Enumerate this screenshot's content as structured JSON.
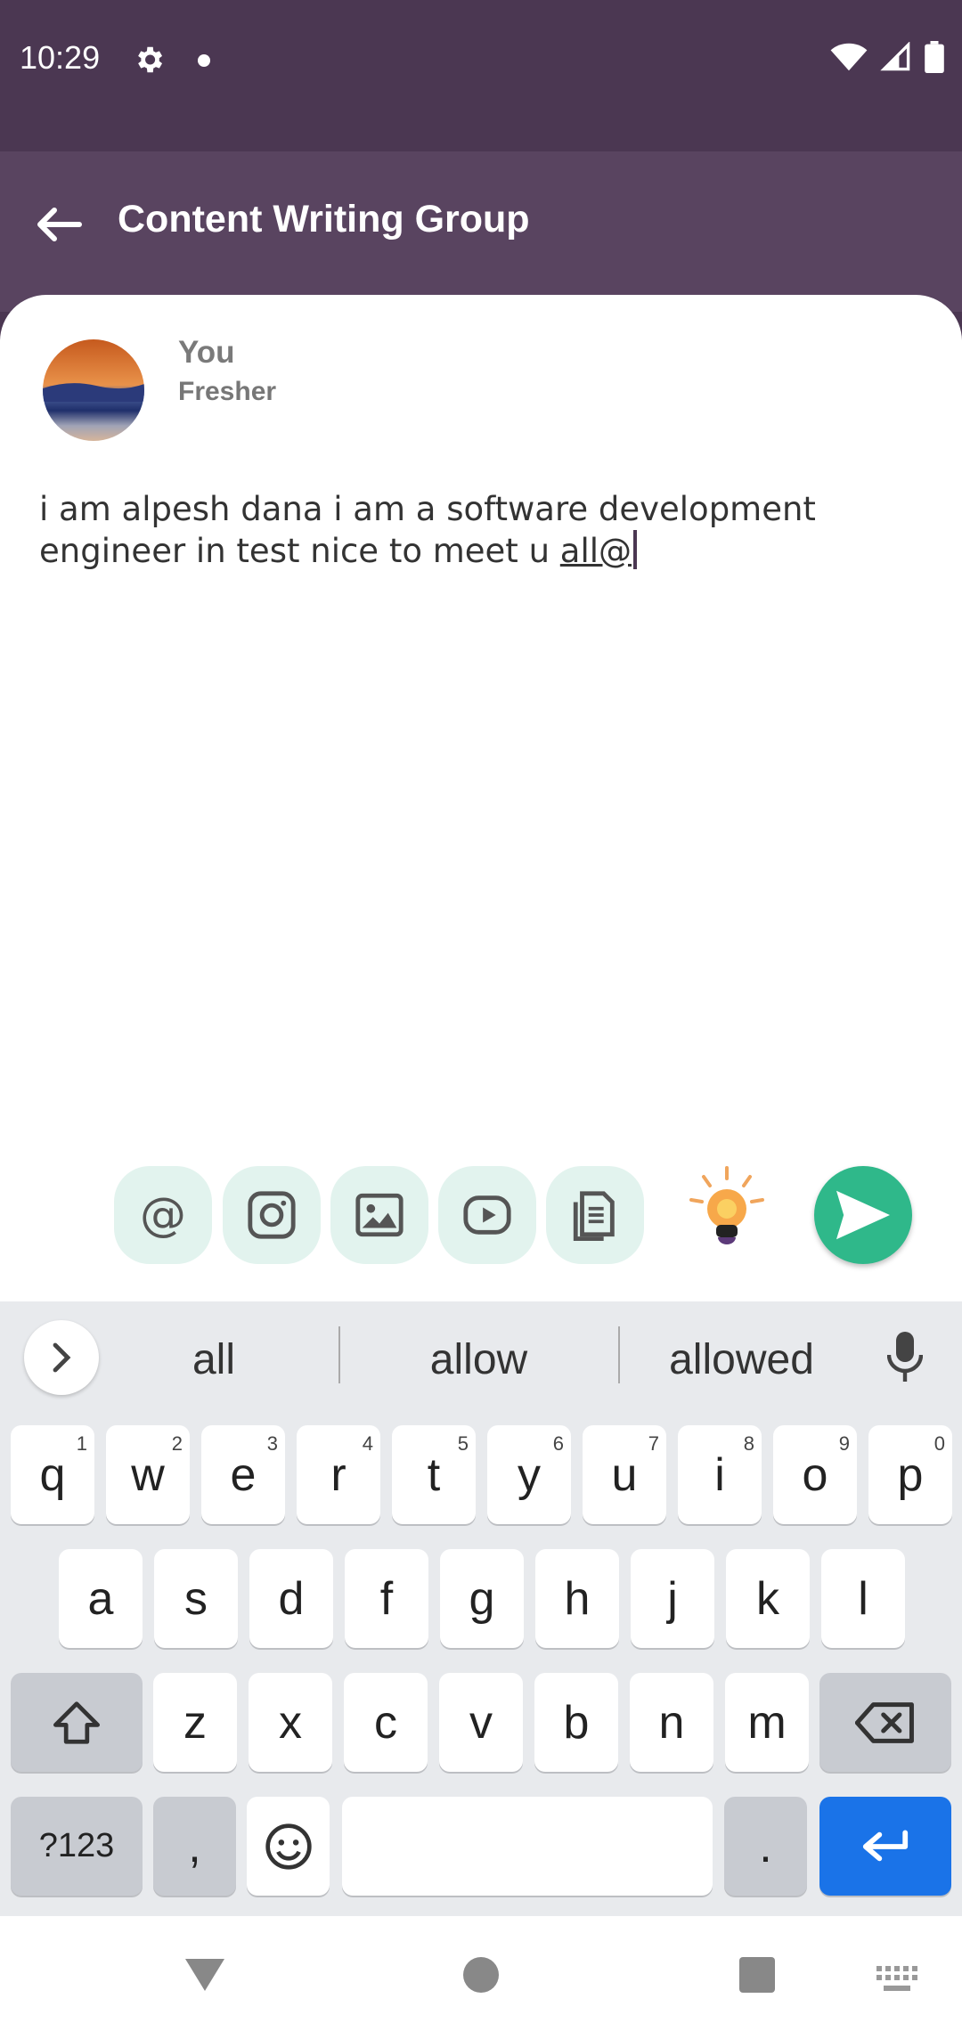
{
  "status_bar": {
    "time": "10:29"
  },
  "app_bar": {
    "title": "Content Writing Group"
  },
  "post": {
    "author": "You",
    "role": "Fresher",
    "text_line1": "i am alpesh dana i am a software development",
    "text_line2_prefix": "engineer in test nice to meet u ",
    "text_line2_underlined": "all@"
  },
  "keyboard": {
    "suggestions": [
      "all",
      "allow",
      "allowed"
    ],
    "row1": [
      {
        "label": "q",
        "hint": "1"
      },
      {
        "label": "w",
        "hint": "2"
      },
      {
        "label": "e",
        "hint": "3"
      },
      {
        "label": "r",
        "hint": "4"
      },
      {
        "label": "t",
        "hint": "5"
      },
      {
        "label": "y",
        "hint": "6"
      },
      {
        "label": "u",
        "hint": "7"
      },
      {
        "label": "i",
        "hint": "8"
      },
      {
        "label": "o",
        "hint": "9"
      },
      {
        "label": "p",
        "hint": "0"
      }
    ],
    "row2": [
      "a",
      "s",
      "d",
      "f",
      "g",
      "h",
      "j",
      "k",
      "l"
    ],
    "row3": [
      "z",
      "x",
      "c",
      "v",
      "b",
      "n",
      "m"
    ],
    "symbols_label": "?123",
    "comma_label": ",",
    "period_label": "."
  },
  "colors": {
    "status_bar_bg": "#4b3752",
    "app_bar_bg": "#594460",
    "send_button": "#2fb88a",
    "tool_button_bg": "#e2f3ee",
    "enter_key": "#1a73e8"
  },
  "icons": {
    "toolbar": [
      "at-icon",
      "instagram-icon",
      "image-icon",
      "youtube-icon",
      "document-icon",
      "lightbulb-icon",
      "send-icon"
    ]
  }
}
